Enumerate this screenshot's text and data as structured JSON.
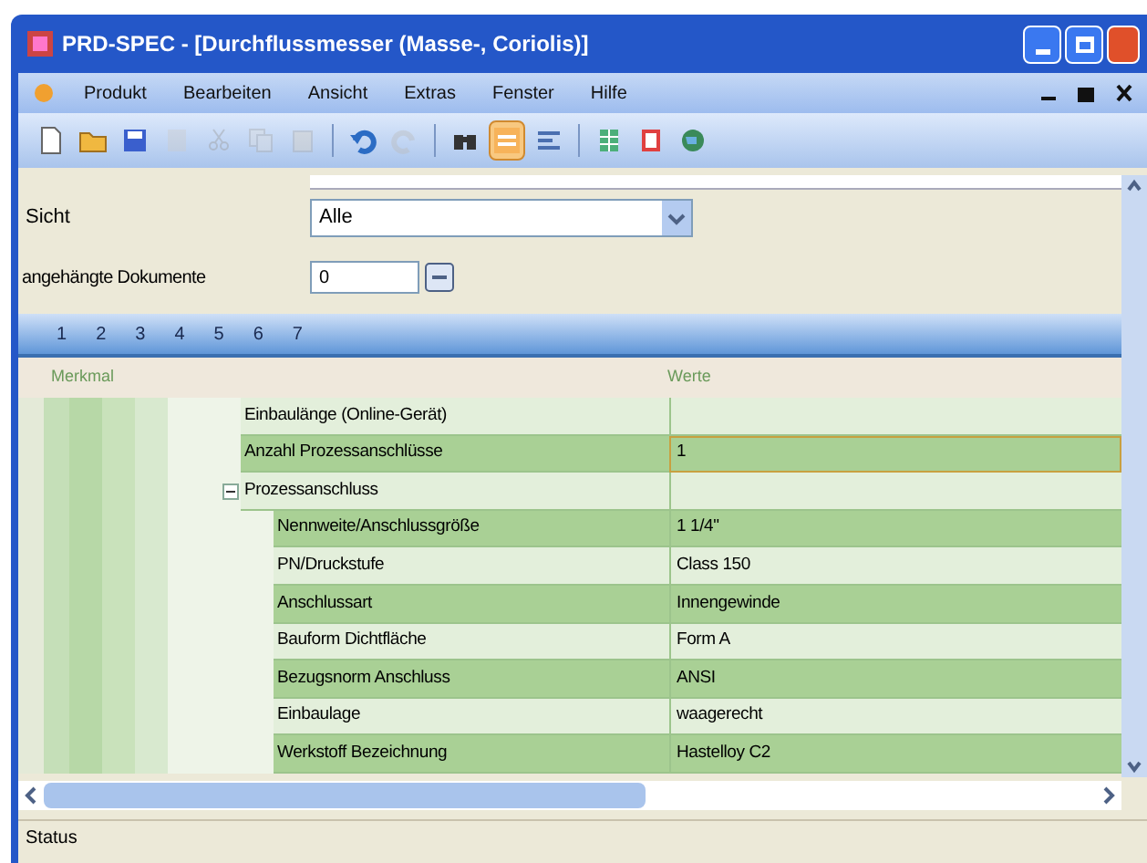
{
  "window": {
    "title": "PRD-SPEC - [Durchflussmesser (Masse-, Coriolis)]"
  },
  "menu": [
    "Produkt",
    "Bearbeiten",
    "Ansicht",
    "Extras",
    "Fenster",
    "Hilfe"
  ],
  "toolbar": [
    {
      "kind": "document",
      "disabled": false,
      "on": false
    },
    {
      "kind": "folder",
      "disabled": false,
      "on": false
    },
    {
      "kind": "disk",
      "disabled": false,
      "on": false
    },
    {
      "kind": "sheet",
      "disabled": true,
      "on": false
    },
    {
      "kind": "scissors",
      "disabled": true,
      "on": false
    },
    {
      "kind": "copy",
      "disabled": true,
      "on": false
    },
    {
      "kind": "paste",
      "disabled": true,
      "on": false
    },
    {
      "kind": "separator"
    },
    {
      "kind": "undo",
      "disabled": false,
      "on": false
    },
    {
      "kind": "redo",
      "disabled": true,
      "on": false
    },
    {
      "kind": "separator"
    },
    {
      "kind": "binoculars",
      "disabled": false,
      "on": false
    },
    {
      "kind": "rows",
      "disabled": false,
      "on": true
    },
    {
      "kind": "lines",
      "disabled": false,
      "on": false
    },
    {
      "kind": "separator"
    },
    {
      "kind": "table",
      "disabled": false,
      "on": false
    },
    {
      "kind": "book",
      "disabled": false,
      "on": false
    },
    {
      "kind": "globe",
      "disabled": false,
      "on": false
    }
  ],
  "form": {
    "sicht_label": "Sicht",
    "sicht_value": "Alle",
    "documents_label": "angehängte Dokumente",
    "documents_value": "0"
  },
  "tabs": [
    {
      "label": "1",
      "selected": false
    },
    {
      "label": "2",
      "selected": false
    },
    {
      "label": "3",
      "selected": false
    },
    {
      "label": "4",
      "selected": false
    },
    {
      "label": "5",
      "selected": false
    },
    {
      "label": "6",
      "selected": false
    },
    {
      "label": "7",
      "selected": false
    }
  ],
  "grid": {
    "columns": [
      "Merkmal",
      "Werte"
    ],
    "rows": [
      {
        "label": "Einbaulänge (Online-Gerät)",
        "value": "",
        "selected": false
      },
      {
        "label": "Anzahl Prozessanschlüsse",
        "value": "1",
        "selected": true
      },
      {
        "label": "Prozessanschluss",
        "value": "",
        "selected": false,
        "expanded": true,
        "children": [
          {
            "label": "Nennweite/Anschlussgröße",
            "value": "1 1/4\"",
            "selected": false
          },
          {
            "label": "PN/Druckstufe",
            "value": "Class 150",
            "selected": false
          },
          {
            "label": "Anschlussart",
            "value": "Innengewinde",
            "selected": false
          },
          {
            "label": "Bauform Dichtfläche",
            "value": "Form A",
            "selected": false
          },
          {
            "label": "Bezugsnorm Anschluss",
            "value": "ANSI",
            "selected": false
          },
          {
            "label": "Einbaulage",
            "value": "waagerecht",
            "selected": false
          },
          {
            "label": "Werkstoff Bezeichnung",
            "value": "Hastelloy C2",
            "selected": false
          }
        ]
      }
    ]
  },
  "status_bar": "Status"
}
